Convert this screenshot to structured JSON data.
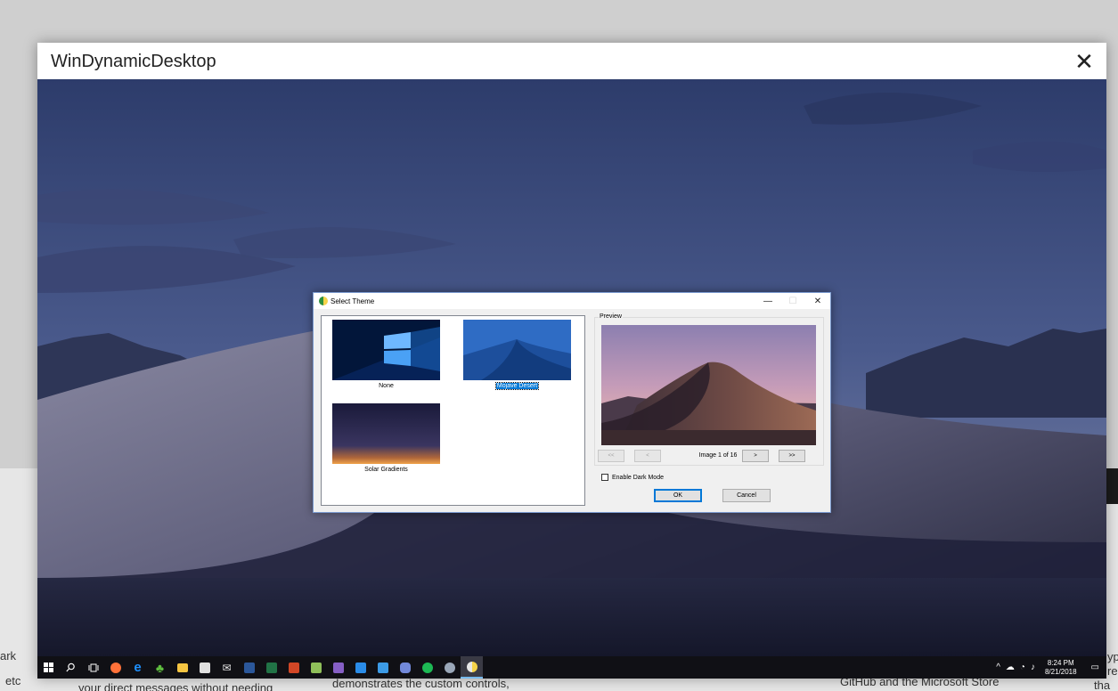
{
  "viewer": {
    "title": "WinDynamicDesktop",
    "close_glyph": "✕"
  },
  "background_page": {
    "snippets": [
      "ark",
      "etc",
      "your direct messages without needing",
      "demonstrates the custom controls,",
      "GitHub and the Microsoft Store",
      "yp",
      "re",
      "tha"
    ]
  },
  "dialog": {
    "title": "Select Theme",
    "minimize_glyph": "—",
    "maximize_glyph": "☐",
    "close_glyph": "✕",
    "themes": [
      {
        "label": "None",
        "selected": false
      },
      {
        "label": "Mojave Desert",
        "selected": true
      },
      {
        "label": "Solar Gradients",
        "selected": false
      }
    ],
    "preview": {
      "caption": "Preview",
      "counter": "Image 1 of 16",
      "first_label": "<<",
      "prev_label": "<",
      "next_label": ">",
      "last_label": ">>"
    },
    "dark_mode_label": "Enable Dark Mode",
    "dark_mode_checked": false,
    "ok_label": "OK",
    "cancel_label": "Cancel"
  },
  "taskbar": {
    "clock_time": "8:24 PM",
    "clock_date": "8/21/2018",
    "apps": [
      {
        "icon": "start-icon",
        "color": "#ffffff"
      },
      {
        "icon": "search-icon",
        "color": "#ffffff"
      },
      {
        "icon": "task-view-icon",
        "color": "#ffffff"
      },
      {
        "icon": "firefox-icon",
        "color": "#ff7139"
      },
      {
        "icon": "edge-icon",
        "color": "#1e90ff"
      },
      {
        "icon": "clover-icon",
        "color": "#5fbf3f"
      },
      {
        "icon": "file-explorer-icon",
        "color": "#f5c542"
      },
      {
        "icon": "store-icon",
        "color": "#e0e0e0"
      },
      {
        "icon": "mail-icon",
        "color": "#e8e8e8"
      },
      {
        "icon": "word-icon",
        "color": "#2b579a"
      },
      {
        "icon": "excel-icon",
        "color": "#217346"
      },
      {
        "icon": "powerpoint-icon",
        "color": "#d24726"
      },
      {
        "icon": "notepad-plus-icon",
        "color": "#8fbf5a"
      },
      {
        "icon": "visual-studio-icon",
        "color": "#865fc5"
      },
      {
        "icon": "vscode-icon",
        "color": "#2a8ce8"
      },
      {
        "icon": "vc-icon",
        "color": "#3c9be6"
      },
      {
        "icon": "discord-icon",
        "color": "#7289da"
      },
      {
        "icon": "spotify-icon",
        "color": "#1db954"
      },
      {
        "icon": "steam-icon",
        "color": "#9aa7b8"
      },
      {
        "icon": "windynamicdesktop-icon",
        "color": "#f5d34a"
      }
    ]
  }
}
